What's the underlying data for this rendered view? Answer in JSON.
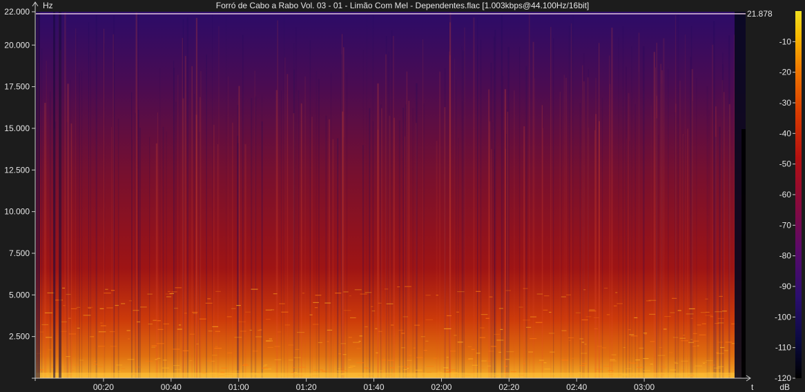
{
  "title": "Forró de Cabo a Rabo Vol. 03 - 01 - Limão Com Mel - Dependentes.flac [1.003kbps@44.100Hz/16bit]",
  "chart_data": {
    "type": "heatmap",
    "subtype": "spectrogram",
    "y_unit": "Hz",
    "x_unit": "t",
    "y_range_hz": [
      0,
      22000
    ],
    "x_range_s": [
      0,
      210
    ],
    "y_ticks": [
      {
        "value": 22000,
        "label": "22.000"
      },
      {
        "value": 20000,
        "label": "20.000"
      },
      {
        "value": 17500,
        "label": "17.500"
      },
      {
        "value": 15000,
        "label": "15.000"
      },
      {
        "value": 12500,
        "label": "12.500"
      },
      {
        "value": 10000,
        "label": "10.000"
      },
      {
        "value": 7500,
        "label": "7.500"
      },
      {
        "value": 5000,
        "label": "5.000"
      },
      {
        "value": 2500,
        "label": "2.500"
      }
    ],
    "x_ticks": [
      {
        "value": 20,
        "label": "00:20"
      },
      {
        "value": 40,
        "label": "00:40"
      },
      {
        "value": 60,
        "label": "01:00"
      },
      {
        "value": 80,
        "label": "01:20"
      },
      {
        "value": 100,
        "label": "01:40"
      },
      {
        "value": 120,
        "label": "02:00"
      },
      {
        "value": 140,
        "label": "02:20"
      },
      {
        "value": 160,
        "label": "02:40"
      },
      {
        "value": 180,
        "label": "03:00"
      }
    ],
    "cutoff": {
      "value_hz": 21878,
      "label": "21.878"
    },
    "colorbar": {
      "unit": "dB",
      "range_db": [
        -120,
        0
      ],
      "ticks": [
        {
          "value": -10,
          "label": "-10"
        },
        {
          "value": -20,
          "label": "-20"
        },
        {
          "value": -30,
          "label": "-30"
        },
        {
          "value": -40,
          "label": "-40"
        },
        {
          "value": -50,
          "label": "-50"
        },
        {
          "value": -60,
          "label": "-60"
        },
        {
          "value": -70,
          "label": "-70"
        },
        {
          "value": -80,
          "label": "-80"
        },
        {
          "value": -90,
          "label": "-90"
        },
        {
          "value": -100,
          "label": "-100"
        },
        {
          "value": -110,
          "label": "-110"
        },
        {
          "value": -120,
          "label": "-120"
        }
      ],
      "colors": [
        "#000000",
        "#0a0a40",
        "#2a0f6e",
        "#5a0a6a",
        "#8a0a3a",
        "#b41010",
        "#d83a00",
        "#f07800",
        "#f8b800",
        "#f0e020"
      ]
    }
  }
}
